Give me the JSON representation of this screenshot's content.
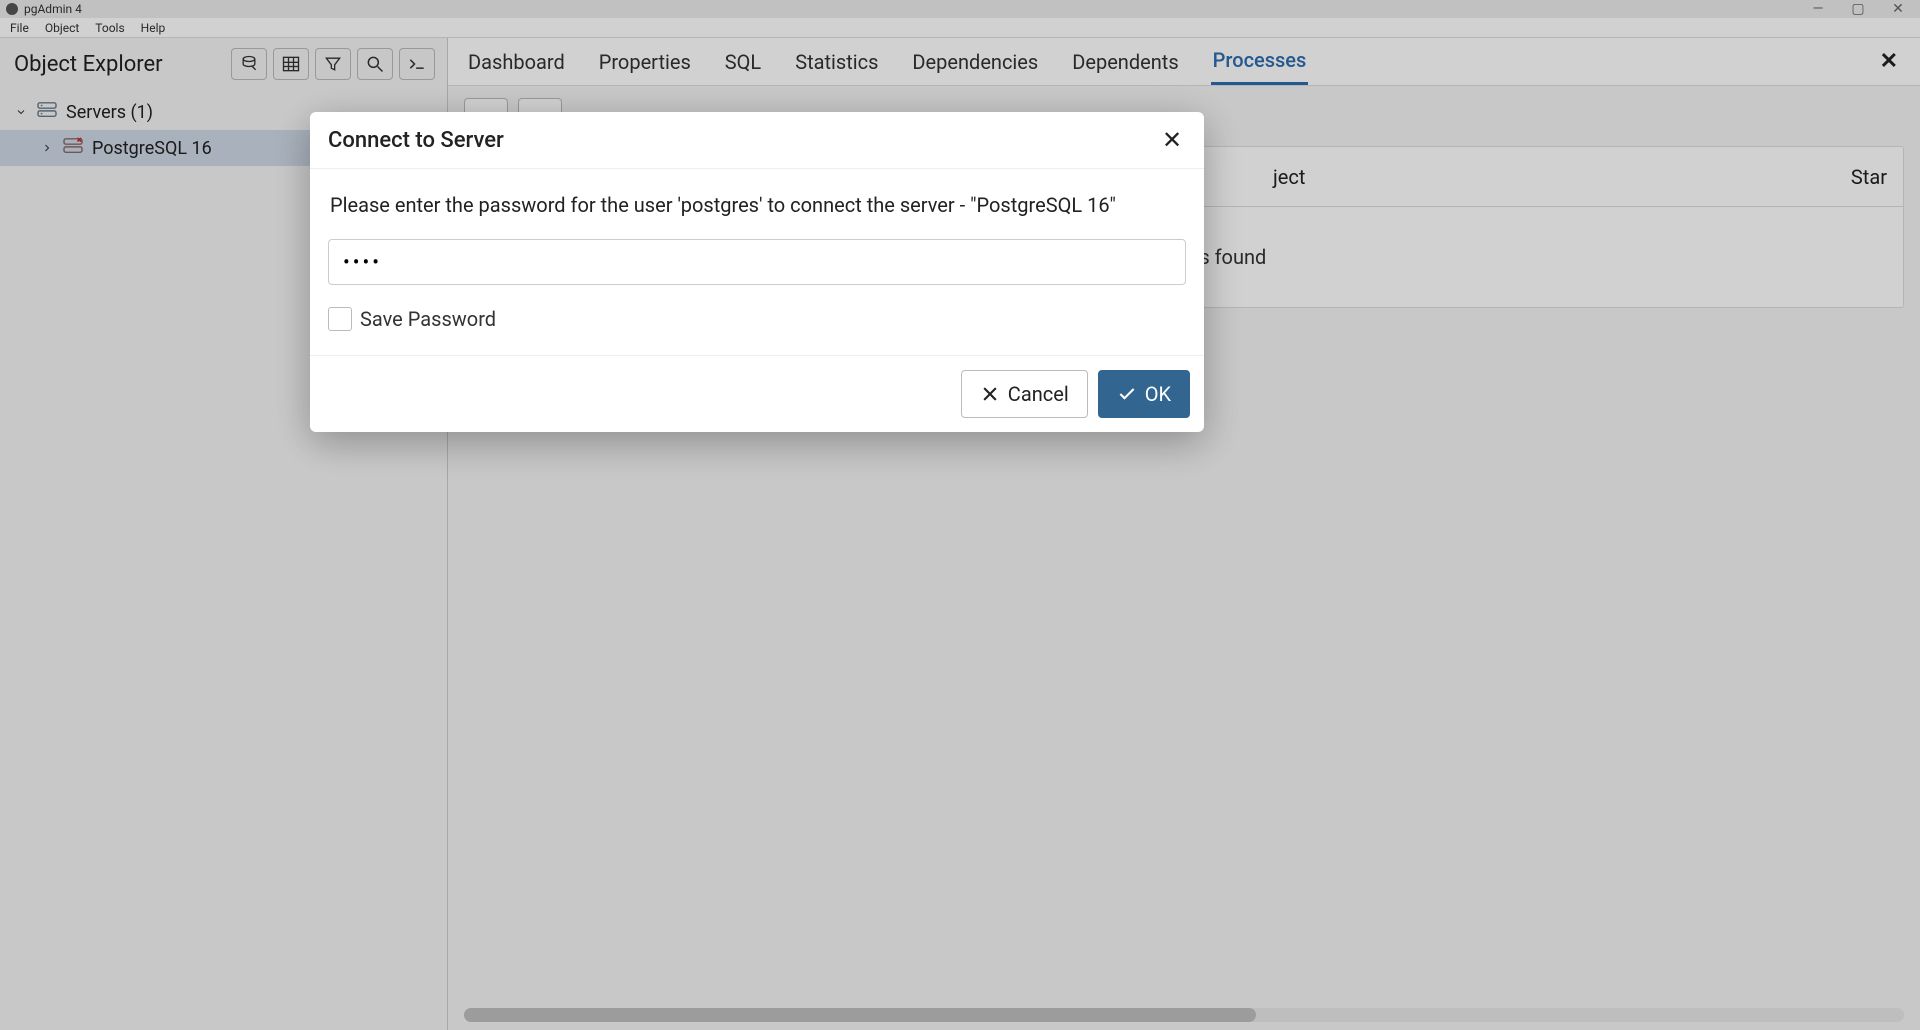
{
  "window": {
    "title": "pgAdmin 4"
  },
  "menubar": {
    "items": [
      "File",
      "Object",
      "Tools",
      "Help"
    ]
  },
  "sidebar": {
    "title": "Object Explorer",
    "servers_label": "Servers (1)",
    "server_name": "PostgreSQL 16"
  },
  "tabs": {
    "items": [
      "Dashboard",
      "Properties",
      "SQL",
      "Statistics",
      "Dependencies",
      "Dependents",
      "Processes"
    ],
    "active": "Processes"
  },
  "table": {
    "headers_visible": [
      "ject",
      "Star"
    ],
    "no_rows": "No rows found"
  },
  "modal": {
    "title": "Connect to Server",
    "message": "Please enter the password for the user 'postgres' to connect the server - \"PostgreSQL 16\"",
    "password_value": "••••",
    "save_password_label": "Save Password",
    "cancel_label": "Cancel",
    "ok_label": "OK"
  }
}
